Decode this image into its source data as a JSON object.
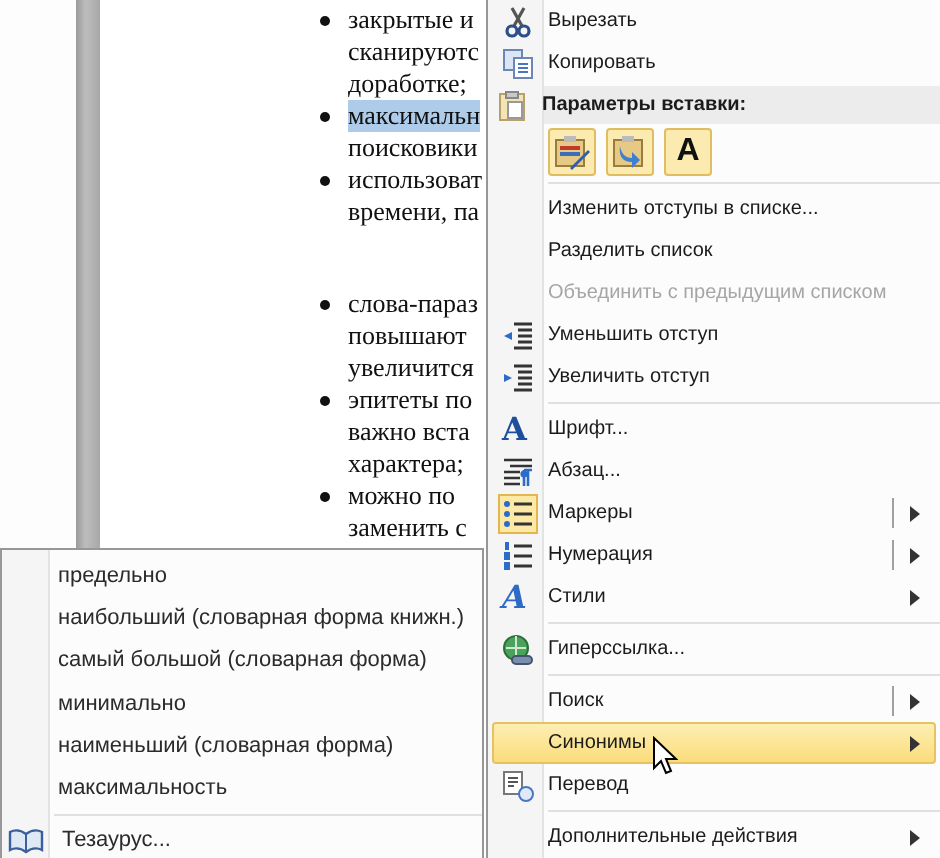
{
  "document": {
    "items": [
      {
        "kind": "bullet",
        "lines": [
          {
            "text": "закрытые и",
            "highlighted": false
          },
          {
            "text": "сканируютс",
            "highlighted": false
          },
          {
            "text": "доработке;",
            "highlighted": false
          }
        ]
      },
      {
        "kind": "bullet",
        "lines": [
          {
            "text": "максимальн",
            "highlighted": true
          },
          {
            "text": "поисковики",
            "highlighted": false
          }
        ]
      },
      {
        "kind": "bullet",
        "lines": [
          {
            "text": "использоват",
            "highlighted": false
          },
          {
            "text": "времени, па",
            "highlighted": false
          }
        ]
      },
      {
        "kind": "blank"
      },
      {
        "kind": "bullet",
        "lines": [
          {
            "text": "слова-параз",
            "highlighted": false
          },
          {
            "text": "повышают",
            "highlighted": false
          },
          {
            "text": "увеличится",
            "highlighted": false
          }
        ]
      },
      {
        "kind": "bullet",
        "lines": [
          {
            "text": "эпитеты по",
            "highlighted": false
          },
          {
            "text": "важно вста",
            "highlighted": false
          },
          {
            "text": "характера;",
            "highlighted": false
          }
        ]
      },
      {
        "kind": "bullet",
        "lines": [
          {
            "text": "можно по",
            "highlighted": false
          },
          {
            "text": "заменить с",
            "highlighted": false
          }
        ]
      }
    ]
  },
  "context_menu": {
    "groups": [
      [
        {
          "kind": "command",
          "label": "Вырезать",
          "disabled": false,
          "checked": false,
          "selected": false,
          "has_submenu": false,
          "split": false
        },
        {
          "kind": "command",
          "label": "Копировать",
          "disabled": false,
          "checked": false,
          "selected": false,
          "has_submenu": false,
          "split": false
        },
        {
          "kind": "header",
          "label": "Параметры вставки:"
        },
        {
          "kind": "paste-options",
          "options": [
            {
              "kind": "keep-format"
            },
            {
              "kind": "merge"
            },
            {
              "kind": "text-only",
              "glyph": "A"
            }
          ]
        }
      ],
      [
        {
          "kind": "command",
          "label": "Изменить отступы в списке...",
          "disabled": false,
          "checked": false,
          "selected": false,
          "has_submenu": false,
          "split": false
        },
        {
          "kind": "command",
          "label": "Разделить список",
          "disabled": false,
          "checked": false,
          "selected": false,
          "has_submenu": false,
          "split": false
        },
        {
          "kind": "command",
          "label": "Объединить с предыдущим списком",
          "disabled": true,
          "checked": false,
          "selected": false,
          "has_submenu": false,
          "split": false
        },
        {
          "kind": "command",
          "label": "Уменьшить отступ",
          "disabled": false,
          "checked": false,
          "selected": false,
          "has_submenu": false,
          "split": false
        },
        {
          "kind": "command",
          "label": "Увеличить отступ",
          "disabled": false,
          "checked": false,
          "selected": false,
          "has_submenu": false,
          "split": false
        }
      ],
      [
        {
          "kind": "command",
          "label": "Шрифт...",
          "glyph": "A",
          "disabled": false,
          "checked": false,
          "selected": false,
          "has_submenu": false,
          "split": false
        },
        {
          "kind": "command",
          "label": "Абзац...",
          "disabled": false,
          "checked": false,
          "selected": false,
          "has_submenu": false,
          "split": false
        },
        {
          "kind": "command",
          "label": "Маркеры",
          "disabled": false,
          "checked": true,
          "selected": false,
          "has_submenu": true,
          "split": true
        },
        {
          "kind": "command",
          "label": "Нумерация",
          "disabled": false,
          "checked": false,
          "selected": false,
          "has_submenu": true,
          "split": true
        },
        {
          "kind": "command",
          "label": "Стили",
          "glyph": "A",
          "disabled": false,
          "checked": false,
          "selected": false,
          "has_submenu": true,
          "split": false
        }
      ],
      [
        {
          "kind": "command",
          "label": "Гиперссылка...",
          "disabled": false,
          "checked": false,
          "selected": false,
          "has_submenu": false,
          "split": false
        }
      ],
      [
        {
          "kind": "command",
          "label": "Поиск",
          "disabled": false,
          "checked": false,
          "selected": false,
          "has_submenu": true,
          "split": true
        },
        {
          "kind": "command",
          "label": "Синонимы",
          "disabled": false,
          "checked": false,
          "selected": true,
          "has_submenu": true,
          "split": false
        },
        {
          "kind": "command",
          "label": "Перевод",
          "disabled": false,
          "checked": false,
          "selected": false,
          "has_submenu": false,
          "split": false
        }
      ],
      [
        {
          "kind": "command",
          "label": "Дополнительные действия",
          "disabled": false,
          "checked": false,
          "selected": false,
          "has_submenu": true,
          "split": false
        }
      ]
    ]
  },
  "synonyms_menu": {
    "items": [
      {
        "label": "предельно"
      },
      {
        "label": "наибольший (словарная форма книжн.)"
      },
      {
        "label": "самый большой (словарная форма)"
      },
      {
        "label": "минимально"
      },
      {
        "label": "наименьший (словарная форма)"
      },
      {
        "label": "максимальность"
      }
    ],
    "footer": {
      "label": "Тезаурус..."
    }
  }
}
